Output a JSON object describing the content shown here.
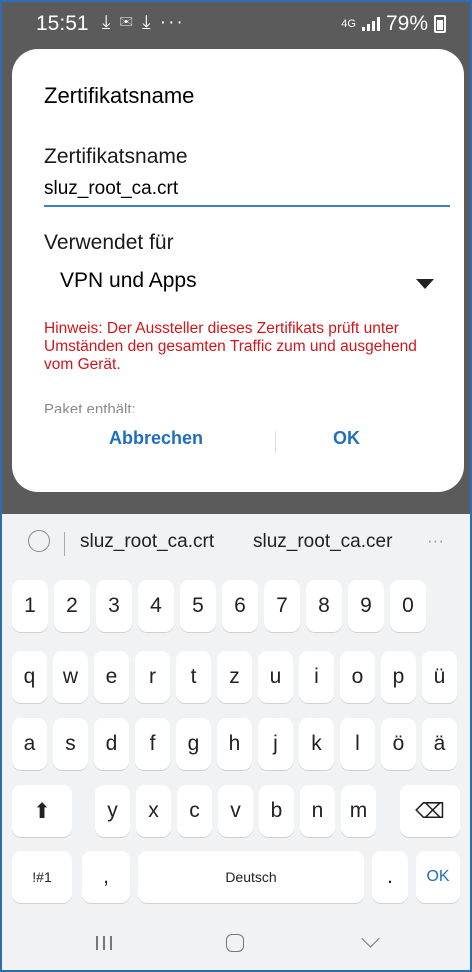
{
  "status": {
    "time": "15:51",
    "left_icons": "⤓ ✉ ⤓ ···",
    "network": "4G",
    "battery": "79%"
  },
  "dialog": {
    "title": "Zertifikatsname",
    "name_label": "Zertifikatsname",
    "name_value": "sluz_root_ca.crt",
    "used_for_label": "Verwendet für",
    "used_for_value": "VPN und Apps",
    "hint": "Hinweis: Der Aussteller dieses Zertifikats prüft unter Umständen den gesamten Traffic zum und ausgehend vom Gerät.",
    "package_label": "Paket enthält:",
    "cancel": "Abbrechen",
    "ok": "OK"
  },
  "keyboard": {
    "suggestions": [
      "sluz_root_ca.crt",
      "sluz_root_ca.cer"
    ],
    "more": "···",
    "rows": [
      [
        "1",
        "2",
        "3",
        "4",
        "5",
        "6",
        "7",
        "8",
        "9",
        "0"
      ],
      [
        "q",
        "w",
        "e",
        "r",
        "t",
        "z",
        "u",
        "i",
        "o",
        "p",
        "ü"
      ],
      [
        "a",
        "s",
        "d",
        "f",
        "g",
        "h",
        "j",
        "k",
        "l",
        "ö",
        "ä"
      ],
      [
        "y",
        "x",
        "c",
        "v",
        "b",
        "n",
        "m"
      ]
    ],
    "shift": "⬆",
    "backspace": "⌫",
    "symbols": "!#1",
    "comma": ",",
    "space": "Deutsch",
    "period": ".",
    "ok": "OK"
  }
}
